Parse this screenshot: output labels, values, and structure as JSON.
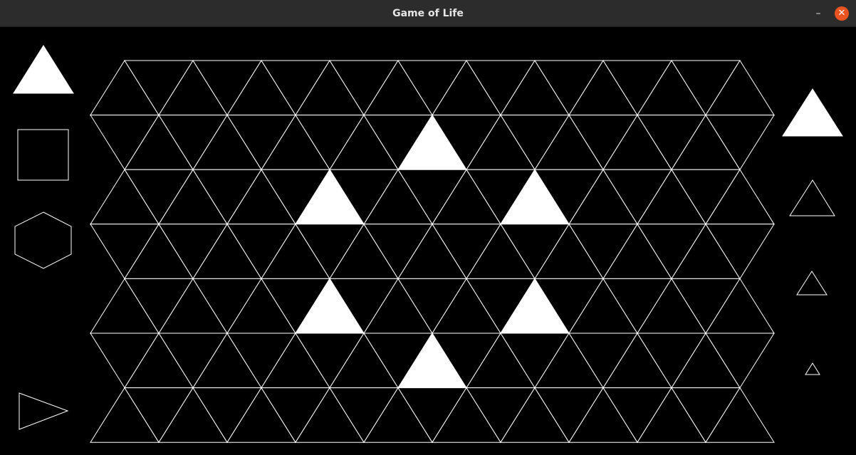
{
  "window": {
    "title": "Game of Life",
    "minimize_glyph": "–",
    "close_glyph": "✕",
    "accent_close": "#e95420"
  },
  "board": {
    "tiling": "triangle",
    "rows": 7,
    "triangles_per_row": 19,
    "alive_cells": [
      {
        "row": 1,
        "index": 9
      },
      {
        "row": 2,
        "index": 6
      },
      {
        "row": 2,
        "index": 12
      },
      {
        "row": 4,
        "index": 6
      },
      {
        "row": 4,
        "index": 12
      },
      {
        "row": 5,
        "index": 9
      }
    ],
    "grid_color": "#ffffff",
    "alive_color": "#ffffff",
    "dead_color": "#000000"
  },
  "left_toolbar": {
    "tools": [
      {
        "id": "triangle-grid",
        "icon": "filled-triangle-icon",
        "selected": true
      },
      {
        "id": "square-grid",
        "icon": "square-outline-icon",
        "selected": false
      },
      {
        "id": "hexagon-grid",
        "icon": "hexagon-outline-icon",
        "selected": false
      },
      {
        "id": "play",
        "icon": "play-outline-icon",
        "selected": false
      }
    ]
  },
  "right_toolbar": {
    "cell_sizes": [
      {
        "id": "xl",
        "icon": "triangle-filled-icon",
        "selected": true
      },
      {
        "id": "l",
        "icon": "triangle-outline-icon",
        "selected": false
      },
      {
        "id": "m",
        "icon": "triangle-outline-icon",
        "selected": false
      },
      {
        "id": "s",
        "icon": "triangle-outline-icon",
        "selected": false
      }
    ]
  }
}
